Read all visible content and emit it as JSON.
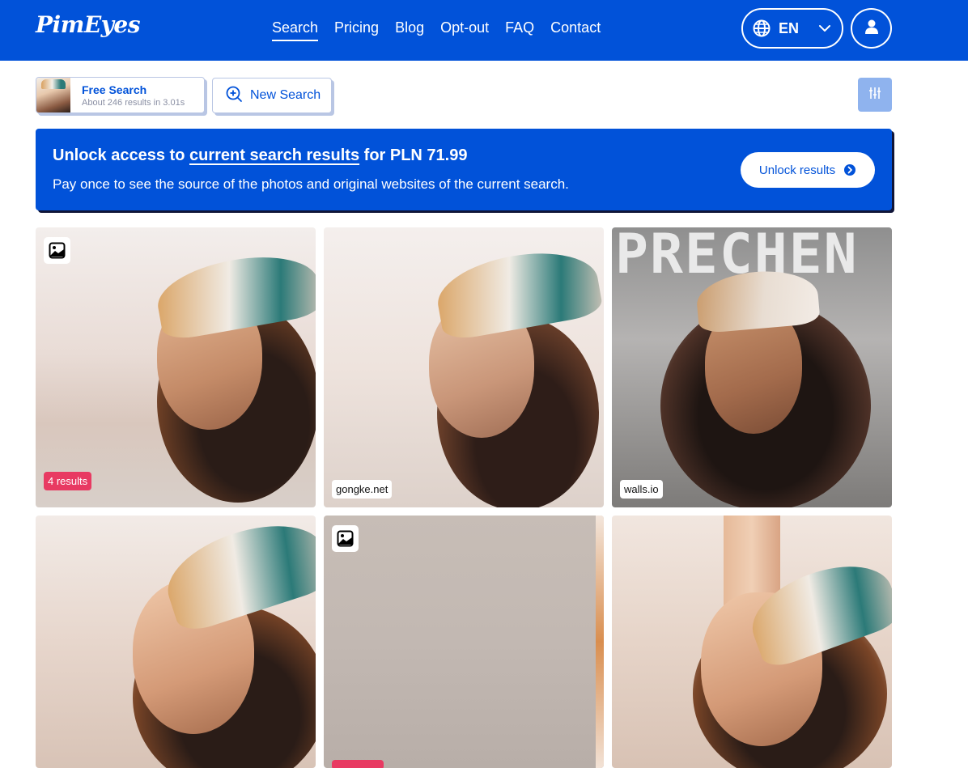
{
  "header": {
    "logo": "PimEyes",
    "nav": [
      "Search",
      "Pricing",
      "Blog",
      "Opt-out",
      "FAQ",
      "Contact"
    ],
    "active_nav": "Search",
    "language": "EN",
    "icons": {
      "language": "globe-icon",
      "dropdown": "chevron-down-icon",
      "account": "user-icon"
    }
  },
  "search": {
    "free_title": "Free Search",
    "free_subtitle": "About 246 results in 3.01s",
    "new_search": "New Search",
    "filter_icon": "sliders-icon"
  },
  "banner": {
    "headline_prefix": "Unlock access to",
    "headline_link": "current search results",
    "headline_suffix": "for PLN 71.99",
    "description": "Pay once to see the source of the photos and original websites of the current search.",
    "button": "Unlock results"
  },
  "results": [
    {
      "badge": "4 results",
      "domain": "",
      "image_icon": true
    },
    {
      "badge": "",
      "domain": "gongke.net",
      "image_icon": false
    },
    {
      "badge": "",
      "domain": "walls.io",
      "image_icon": false,
      "overlay_text": "PRECHEN"
    },
    {
      "badge": "",
      "domain": "",
      "image_icon": false
    },
    {
      "badge": "",
      "domain": "",
      "image_icon": true
    },
    {
      "badge": "",
      "domain": "",
      "image_icon": false
    }
  ],
  "colors": {
    "brand": "#0152d9",
    "badge": "#e83a62",
    "filter_button": "#8fb3ee"
  }
}
